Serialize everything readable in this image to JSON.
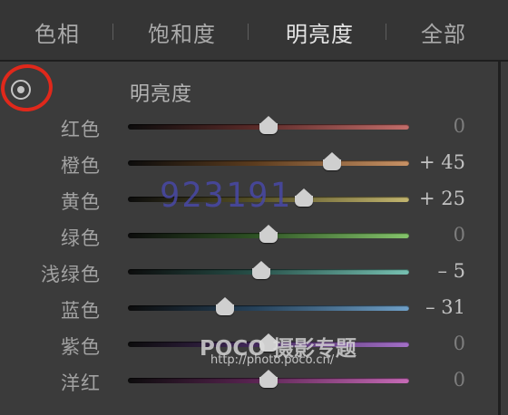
{
  "tabs": [
    {
      "label": "色相",
      "active": false
    },
    {
      "label": "饱和度",
      "active": false
    },
    {
      "label": "明亮度",
      "active": true
    },
    {
      "label": "全部",
      "active": false
    }
  ],
  "section_title": "明亮度",
  "sliders": [
    {
      "label": "红色",
      "value": "0",
      "level": 0,
      "track_colors": [
        "#0c0c0c",
        "#5a2a28",
        "#c36d6a"
      ]
    },
    {
      "label": "橙色",
      "value": "+ 45",
      "level": 45,
      "track_colors": [
        "#0c0c0c",
        "#5c3c1e",
        "#c99265"
      ]
    },
    {
      "label": "黄色",
      "value": "+ 25",
      "level": 25,
      "track_colors": [
        "#0c0c0c",
        "#565026",
        "#c2b56f"
      ]
    },
    {
      "label": "绿色",
      "value": "0",
      "level": 0,
      "track_colors": [
        "#0c0c0c",
        "#2e5224",
        "#84c46b"
      ]
    },
    {
      "label": "浅绿色",
      "value": "– 5",
      "level": -5,
      "track_colors": [
        "#0c0c0c",
        "#275049",
        "#77c1b2"
      ]
    },
    {
      "label": "蓝色",
      "value": "– 31",
      "level": -31,
      "track_colors": [
        "#0c0c0c",
        "#26425a",
        "#6fa0c8"
      ]
    },
    {
      "label": "紫色",
      "value": "0",
      "level": 0,
      "track_colors": [
        "#0c0c0c",
        "#42285a",
        "#a36fc7"
      ]
    },
    {
      "label": "洋红",
      "value": "0",
      "level": 0,
      "track_colors": [
        "#0c0c0c",
        "#5a2452",
        "#c76bb7"
      ]
    }
  ],
  "watermark": {
    "code": "923191",
    "logo": "POCO 摄影专题",
    "url": "http://photo.poco.cn/"
  },
  "icons": {
    "target_adjust": "target-adjustment-icon"
  },
  "colors": {
    "annotation": "#e0281b",
    "panel": "#3b3b3b"
  }
}
